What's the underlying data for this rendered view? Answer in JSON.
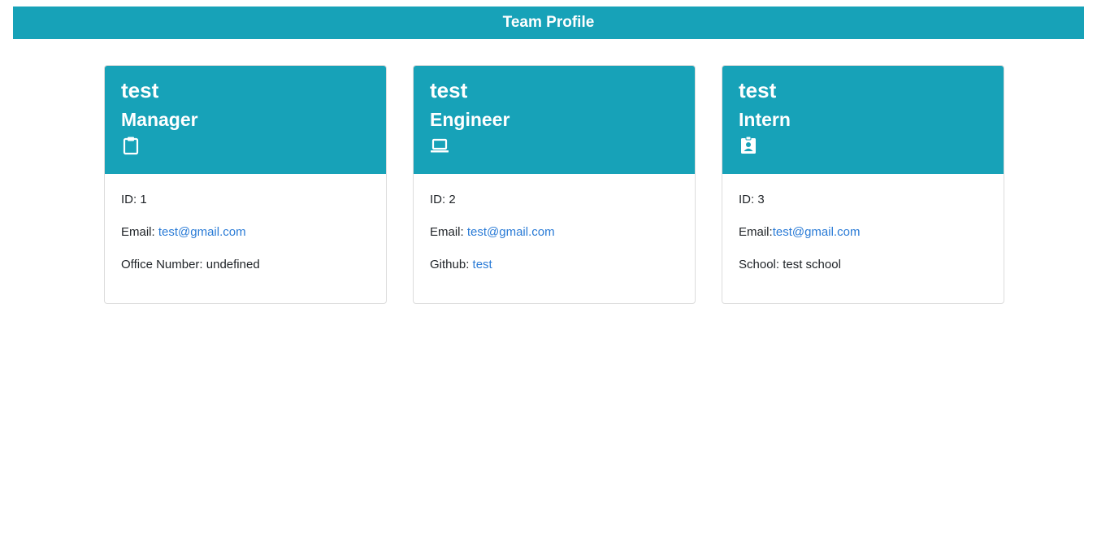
{
  "header": {
    "title": "Team Profile"
  },
  "cards": [
    {
      "name": "test",
      "role": "Manager",
      "icon": "clipboard-icon",
      "id_label": "ID: ",
      "id_value": "1",
      "email_label": "Email: ",
      "email": "test@gmail.com",
      "extra_label": "Office Number: ",
      "extra_value": "undefined"
    },
    {
      "name": "test",
      "role": "Engineer",
      "icon": "laptop-icon",
      "id_label": "ID: ",
      "id_value": "2",
      "email_label": "Email: ",
      "email": "test@gmail.com",
      "extra_label": "Github: ",
      "extra_value": "test"
    },
    {
      "name": "test",
      "role": "Intern",
      "icon": "user-badge-icon",
      "id_label": "ID: ",
      "id_value": "3",
      "email_label": "Email:",
      "email": "test@gmail.com",
      "extra_label": "School: ",
      "extra_value": "test school"
    }
  ],
  "colors": {
    "accent": "#17a2b8",
    "link": "#2a7bd6"
  }
}
